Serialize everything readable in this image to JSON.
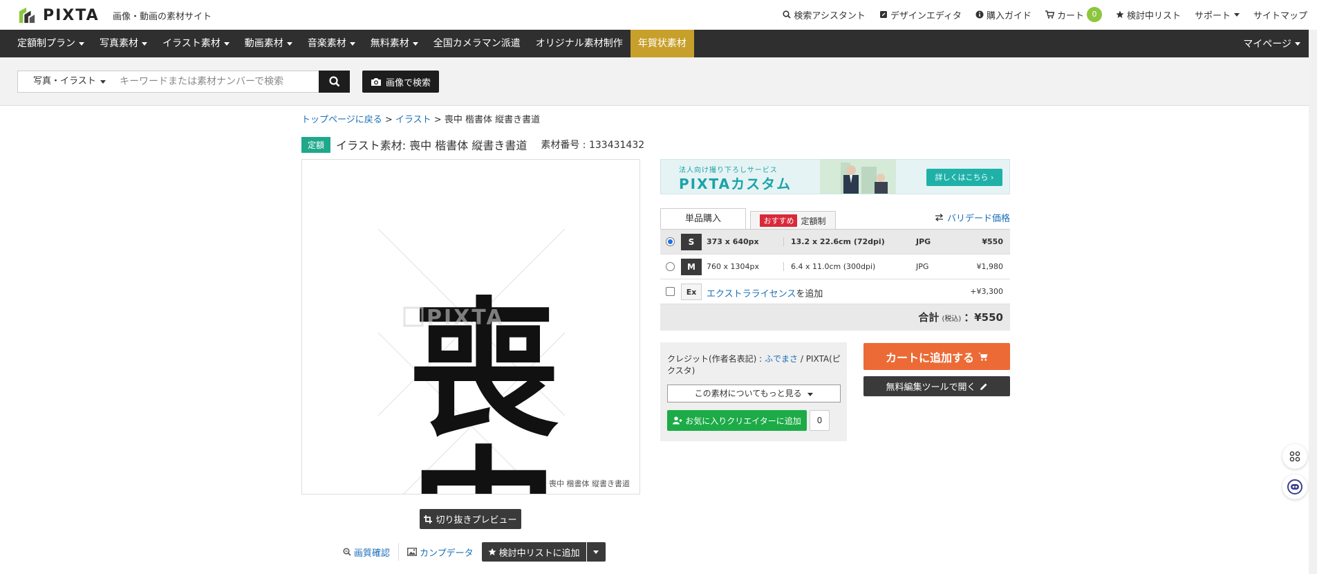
{
  "header": {
    "logo_text": "PIXTA",
    "tagline": "画像・動画の素材サイト",
    "links": [
      {
        "icon": "search-icon",
        "label": "検索アシスタント"
      },
      {
        "icon": "edit-square-icon",
        "label": "デザインエディタ"
      },
      {
        "icon": "info-icon",
        "label": "購入ガイド"
      },
      {
        "icon": "cart-icon",
        "label": "カート"
      },
      {
        "icon": "star-icon",
        "label": "検討中リスト"
      },
      {
        "icon": "",
        "label": "サポート"
      },
      {
        "icon": "",
        "label": "サイトマップ"
      }
    ],
    "cart_count": "0"
  },
  "nav": {
    "items": [
      {
        "label": "定額制プラン",
        "dropdown": true
      },
      {
        "label": "写真素材",
        "dropdown": true
      },
      {
        "label": "イラスト素材",
        "dropdown": true
      },
      {
        "label": "動画素材",
        "dropdown": true
      },
      {
        "label": "音楽素材",
        "dropdown": true
      },
      {
        "label": "無料素材",
        "dropdown": true
      },
      {
        "label": "全国カメラマン派遣",
        "dropdown": false
      },
      {
        "label": "オリジナル素材制作",
        "dropdown": false
      },
      {
        "label": "年賀状素材",
        "dropdown": false,
        "highlight": true
      }
    ],
    "mypage": "マイページ"
  },
  "search": {
    "category": "写真・イラスト",
    "placeholder": "キーワードまたは素材ナンバーで検索",
    "image_search_label": "画像で検索"
  },
  "breadcrumb": {
    "home": "トップページに戻る",
    "sep": " > ",
    "category": "イラスト",
    "current": "喪中 楷書体 縦書き書道"
  },
  "item": {
    "plan_tag": "定額",
    "title": "イラスト素材: 喪中 楷書体 縦書き書道",
    "number": "素材番号 : 133431432",
    "calligraphy": "喪中",
    "watermark": "PIXTA",
    "caption": "喪中 楷書体 縦書き書道"
  },
  "actions": {
    "crop_preview": "切り抜きプレビュー",
    "quality_check": "画質確認",
    "comp_data": "カンプデータ",
    "wishlist_add": "検討中リストに追加"
  },
  "banner": {
    "sub": "法人向け撮り下ろしサービス",
    "title": "PIXTAカスタム",
    "button": "詳しくはこちら ›"
  },
  "purchase": {
    "tab_single": "単品購入",
    "tab_recommend_badge": "おすすめ",
    "tab_subscription": "定額制",
    "bulk_price_link": "バリデード価格",
    "rows": [
      {
        "size": "S",
        "px": "373 x 640px",
        "cm": "13.2 x 22.6cm (72dpi)",
        "format": "JPG",
        "price": "¥550",
        "selected": true
      },
      {
        "size": "M",
        "px": "760 x 1304px",
        "cm": "6.4 x 11.0cm (300dpi)",
        "format": "JPG",
        "price": "¥1,980",
        "selected": false
      }
    ],
    "extra": {
      "size": "Ex",
      "link": "エクストラライセンス",
      "suffix": "を追加",
      "price": "+¥3,300"
    },
    "total_label": "合計",
    "total_tax": "(税込)",
    "total_value": "：¥550"
  },
  "credit": {
    "label": "クレジット(作者名表記) : ",
    "author": "ふでまさ",
    "suffix": " / PIXTA(ピクスタ)",
    "more_button": "この素材についてもっと見る",
    "favorite_button": "お気に入りクリエイターに追加",
    "favorite_count": "0"
  },
  "buttons": {
    "add_to_cart": "カートに追加する",
    "free_edit": "無料編集ツールで開く"
  },
  "colors": {
    "nav_bg": "#2f2f2f",
    "nav_highlight": "#c7a02b",
    "plan_tag": "#1fa88a",
    "cart_button": "#ec6a35",
    "favorite_button": "#1cab47",
    "link": "#1a6eb8",
    "cart_badge": "#8cc63f"
  }
}
